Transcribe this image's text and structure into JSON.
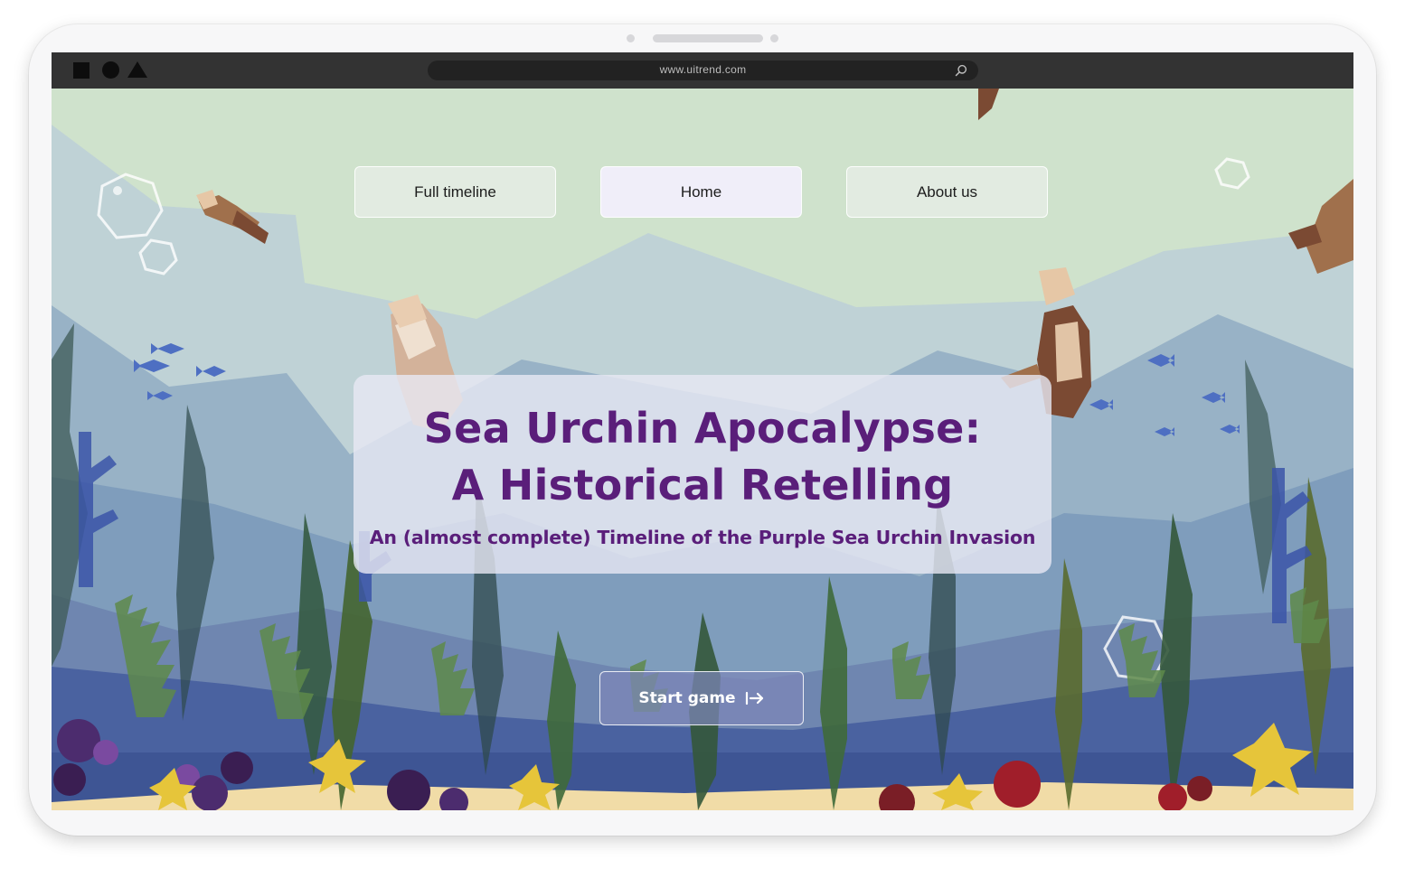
{
  "browser": {
    "url": "www.uitrend.com",
    "window_controls": [
      "square-icon",
      "circle-icon",
      "triangle-icon"
    ],
    "search_icon": "search-icon"
  },
  "nav": {
    "items": [
      {
        "label": "Full timeline",
        "active": false
      },
      {
        "label": "Home",
        "active": true
      },
      {
        "label": "About us",
        "active": false
      }
    ]
  },
  "hero": {
    "title_line1": "Sea Urchin Apocalypse:",
    "title_line2": "A Historical Retelling",
    "subtitle": "An (almost complete) Timeline of the Purple Sea Urchin Invasion"
  },
  "cta": {
    "label": "Start game",
    "icon": "arrow-right-to-bar-icon"
  },
  "colors": {
    "title": "#5a1e7a",
    "sky": "#cfe2cc",
    "water_deep": "#4a62a0",
    "browser_bar": "#333333"
  }
}
